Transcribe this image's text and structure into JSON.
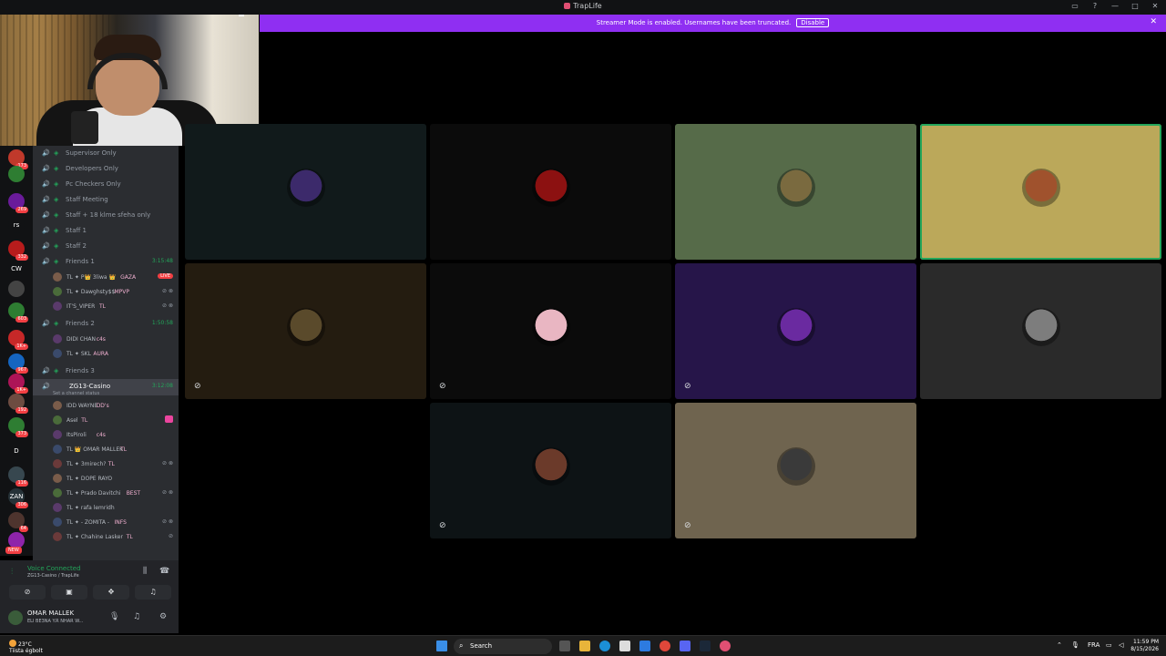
{
  "window": {
    "title": "TrapLife"
  },
  "banner": {
    "message": "Streamer Mode is enabled. Usernames have been truncated.",
    "disable_label": "Disable"
  },
  "servers": [
    {
      "label": "",
      "badge": "173",
      "color": "#c0392b"
    },
    {
      "label": "",
      "badge": "",
      "color": "#2e7d32"
    },
    {
      "label": "",
      "badge": "269",
      "color": "#6a1b9a"
    },
    {
      "label": "rs",
      "badge": "",
      "color": "#111214"
    },
    {
      "label": "",
      "badge": "332",
      "color": "#b71c1c"
    },
    {
      "label": "CW",
      "badge": "",
      "color": "#111214"
    },
    {
      "label": "",
      "badge": "",
      "color": "#444"
    },
    {
      "label": "",
      "badge": "603",
      "color": "#2e7d32"
    },
    {
      "label": "",
      "badge": "1K+",
      "color": "#c62828"
    },
    {
      "label": "",
      "badge": "967",
      "color": "#1565c0"
    },
    {
      "label": "",
      "badge": "1K+",
      "color": "#ad1457"
    },
    {
      "label": "",
      "badge": "192",
      "color": "#6d4c41"
    },
    {
      "label": "",
      "badge": "373",
      "color": "#2e7d32"
    },
    {
      "label": "D",
      "badge": "",
      "color": "#111214"
    },
    {
      "label": "",
      "badge": "116",
      "color": "#37474f"
    },
    {
      "label": "ZAN",
      "badge": "306",
      "color": "#263238"
    },
    {
      "label": "",
      "badge": "64",
      "color": "#4e342e"
    },
    {
      "label": "",
      "badge": "",
      "color": "#8e24aa"
    }
  ],
  "server_new": "NEW",
  "channels": [
    {
      "name": "Supervisor Only",
      "timer": ""
    },
    {
      "name": "Developers Only",
      "timer": ""
    },
    {
      "name": "Pc Checkers Only",
      "timer": ""
    },
    {
      "name": "Staff Meeting",
      "timer": ""
    },
    {
      "name": "Staff + 18 klme sfeha only",
      "timer": ""
    },
    {
      "name": "Staff 1",
      "timer": ""
    },
    {
      "name": "Staff 2",
      "timer": ""
    },
    {
      "name": "Friends 1",
      "timer": "3:15:48"
    }
  ],
  "friends1_users": [
    {
      "name": "TL ✦ P👑 3liwa 👑",
      "tag": "GAZA",
      "extra": "LIVE"
    },
    {
      "name": "TL ✦ Dawghsty$$",
      "tag": "MPVP",
      "extra": ""
    },
    {
      "name": "IT'S_VIPER",
      "tag": "TL",
      "extra": ""
    }
  ],
  "friends2": {
    "name": "Friends 2",
    "timer": "1:50:58"
  },
  "friends2_users": [
    {
      "name": "DIDI CHAN",
      "tag": "c4s"
    },
    {
      "name": "TL ✦ SKL",
      "tag": "AURA"
    }
  ],
  "friends3": {
    "name": "Friends 3"
  },
  "active_channel": {
    "name": "ZG13-Casino",
    "timer": "3:12:08",
    "status": "Set a channel status"
  },
  "casino_users": [
    {
      "name": "IDD WAYNE",
      "tag": "DD's"
    },
    {
      "name": "Asel",
      "tag": "TL"
    },
    {
      "name": "ItsPiroli",
      "tag": "c4s"
    },
    {
      "name": "TL 👑 OMAR MALLEK",
      "tag": "TL"
    },
    {
      "name": "TL ✦ 3mirech?",
      "tag": "TL"
    },
    {
      "name": "TL ✦ DOPE RAYO",
      "tag": ""
    },
    {
      "name": "TL ✦ Prado Davitchi",
      "tag": "BEST"
    },
    {
      "name": "TL ✦ rafa lemridh",
      "tag": ""
    },
    {
      "name": "TL ✦ - ZOMITA -",
      "tag": "INFS"
    },
    {
      "name": "TL ✦ Chahine Lasker",
      "tag": "TL"
    }
  ],
  "voice": {
    "status": "Voice Connected",
    "location": "ZG13-Casino / TrapLife"
  },
  "user": {
    "name": "OMAR MALLEK",
    "status": "ELI BE3NA Y.R NHAR W..."
  },
  "tiles": [
    {
      "bg": "#111a1b",
      "avatar": "#3c2a6b",
      "muted": false,
      "speaking": false
    },
    {
      "bg": "#0b0b0b",
      "avatar": "#8c1111",
      "muted": false,
      "speaking": false
    },
    {
      "bg": "#566b49",
      "avatar": "#7a6a3f",
      "muted": false,
      "speaking": false
    },
    {
      "bg": "#bba85a",
      "avatar": "#a0522d",
      "muted": false,
      "speaking": true
    },
    {
      "bg": "#241c10",
      "avatar": "#5a4a2b",
      "muted": true,
      "speaking": false
    },
    {
      "bg": "#0b0b0b",
      "avatar": "#e9b6c2",
      "muted": true,
      "speaking": false
    },
    {
      "bg": "#261549",
      "avatar": "#6a2aa0",
      "muted": true,
      "speaking": false
    },
    {
      "bg": "#2a2a2a",
      "avatar": "#7d7d7d",
      "muted": false,
      "speaking": false
    },
    {
      "bg": "#0d1315",
      "avatar": "#6b3a2a",
      "muted": true,
      "speaking": false
    },
    {
      "bg": "#6f644f",
      "avatar": "#3a3a3a",
      "muted": true,
      "speaking": false
    }
  ],
  "taskbar": {
    "weather_temp": "23°C",
    "weather_desc": "Tiista égbolt",
    "search_label": "Search",
    "lang": "FRA",
    "time": "11:59 PM",
    "date": "8/15/2026"
  }
}
